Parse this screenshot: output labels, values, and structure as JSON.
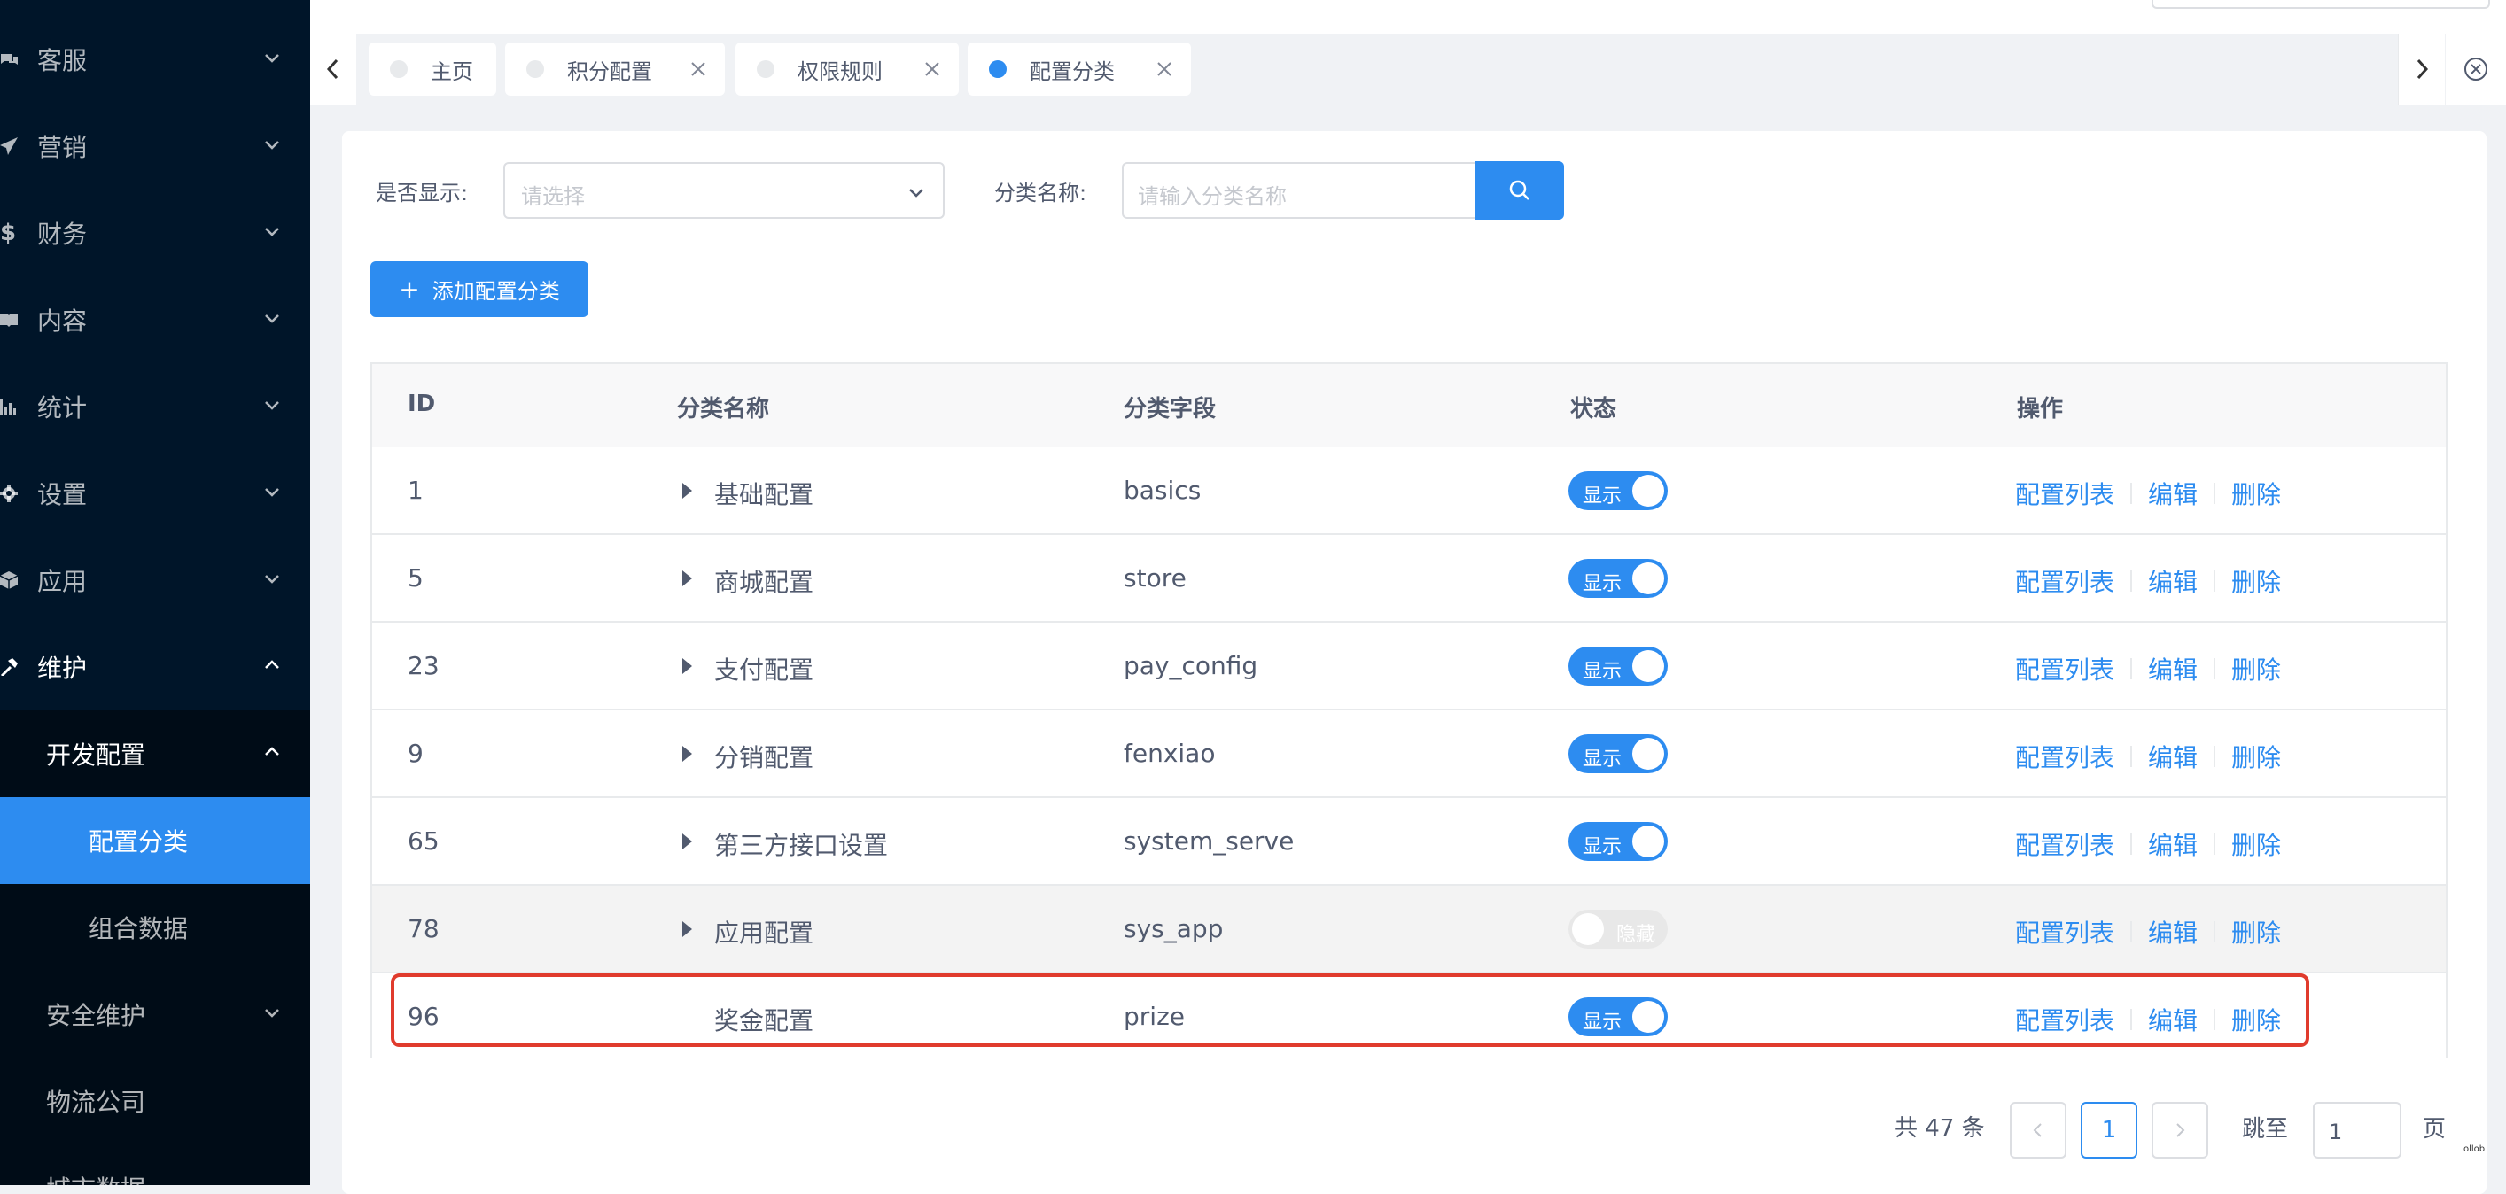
{
  "sidebar": {
    "items": [
      {
        "label": "客服",
        "icon": "chat-icon"
      },
      {
        "label": "营销",
        "icon": "send-icon"
      },
      {
        "label": "财务",
        "icon": "dollar-icon"
      },
      {
        "label": "内容",
        "icon": "book-icon"
      },
      {
        "label": "统计",
        "icon": "bar-chart-icon"
      },
      {
        "label": "设置",
        "icon": "gear-icon"
      },
      {
        "label": "应用",
        "icon": "cube-icon"
      },
      {
        "label": "维护",
        "icon": "hammer-icon"
      }
    ],
    "submenu": {
      "group_label": "开发配置",
      "children": [
        "配置分类",
        "组合数据"
      ],
      "siblings": [
        "安全维护",
        "物流公司",
        "城市数据"
      ]
    }
  },
  "tabs": [
    {
      "label": "主页"
    },
    {
      "label": "积分配置"
    },
    {
      "label": "权限规则"
    },
    {
      "label": "配置分类"
    }
  ],
  "filters": {
    "show_label": "是否显示:",
    "show_placeholder": "请选择",
    "name_label": "分类名称:",
    "name_placeholder": "请输入分类名称"
  },
  "add_button_label": "添加配置分类",
  "table": {
    "headers": [
      "ID",
      "分类名称",
      "分类字段",
      "状态",
      "操作"
    ],
    "rows": [
      {
        "id": "1",
        "name": "基础配置",
        "field": "basics",
        "status": "显示"
      },
      {
        "id": "5",
        "name": "商城配置",
        "field": "store",
        "status": "显示"
      },
      {
        "id": "23",
        "name": "支付配置",
        "field": "pay_config",
        "status": "显示"
      },
      {
        "id": "9",
        "name": "分销配置",
        "field": "fenxiao",
        "status": "显示"
      },
      {
        "id": "65",
        "name": "第三方接口设置",
        "field": "system_serve",
        "status": "显示"
      },
      {
        "id": "78",
        "name": "应用配置",
        "field": "sys_app",
        "status": "隐藏"
      },
      {
        "id": "96",
        "name": "奖金配置",
        "field": "prize",
        "status": "显示"
      }
    ],
    "actions": [
      "配置列表",
      "编辑",
      "删除"
    ]
  },
  "pagination": {
    "total": "共 47 条",
    "current": "1",
    "jump_label": "跳至",
    "jump_value": "1",
    "jump_unit": "页"
  },
  "corner_mark": "ollob",
  "colors": {
    "primary": "#2d8cf0",
    "sidebar": "#001529",
    "highlight": "#e03b2d"
  }
}
